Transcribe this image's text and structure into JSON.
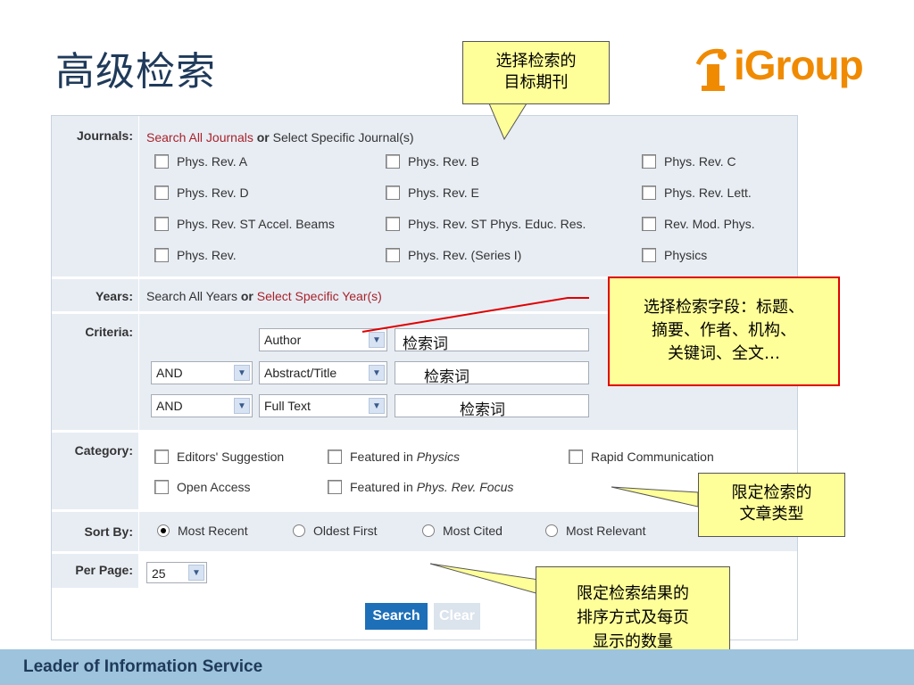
{
  "slide": {
    "title": "高级检索",
    "logo_text": "iGroup",
    "footer": "Leader of Information Service"
  },
  "form": {
    "journals": {
      "label": "Journals:",
      "search_all_link": "Search All Journals",
      "or": "or",
      "select_specific": "Select Specific Journal(s)",
      "options": [
        "Phys. Rev. A",
        "Phys. Rev. B",
        "Phys. Rev. C",
        "Phys. Rev. D",
        "Phys. Rev. E",
        "Phys. Rev. Lett.",
        "Phys. Rev. ST Accel. Beams",
        "Phys. Rev. ST Phys. Educ. Res.",
        "Rev. Mod. Phys.",
        "Phys. Rev.",
        "Phys. Rev. (Series I)",
        "Physics"
      ]
    },
    "years": {
      "label": "Years:",
      "search_all": "Search All Years",
      "or": "or",
      "select_specific_link": "Select Specific Year(s)"
    },
    "criteria": {
      "label": "Criteria:",
      "rows": [
        {
          "operator": "",
          "field": "Author",
          "term": "检索词"
        },
        {
          "operator": "AND",
          "field": "Abstract/Title",
          "term": "检索词"
        },
        {
          "operator": "AND",
          "field": "Full Text",
          "term": "检索词"
        }
      ]
    },
    "category": {
      "label": "Category:",
      "options": [
        "Editors' Suggestion",
        "Featured in",
        "Rapid Communication",
        "Open Access",
        "Featured in"
      ],
      "featured_physics_italic": "Physics",
      "featured_focus_italic": "Phys. Rev. Focus"
    },
    "sort_by": {
      "label": "Sort By:",
      "options": [
        "Most Recent",
        "Oldest First",
        "Most Cited",
        "Most Relevant"
      ],
      "selected": "Most Recent"
    },
    "per_page": {
      "label": "Per Page:",
      "value": "25"
    },
    "buttons": {
      "search": "Search",
      "clear": "Clear"
    }
  },
  "callouts": {
    "target_journal": [
      "选择检索的",
      "目标期刊"
    ],
    "fields": [
      "选择检索字段：标题、",
      "摘要、作者、机构、",
      "关键词、全文…"
    ],
    "article_type": [
      "限定检索的",
      "文章类型"
    ],
    "sort_count": [
      "限定检索结果的",
      "排序方式及每页",
      "显示的数量"
    ]
  },
  "colors": {
    "link": "#a8222a",
    "panel_bg": "#e8edf4",
    "search_btn": "#1d6fb8",
    "clear_btn": "#dbe3ec",
    "callout_bg": "#ffff99",
    "footer_bg": "#9dc3dd",
    "logo": "#f08a00"
  }
}
